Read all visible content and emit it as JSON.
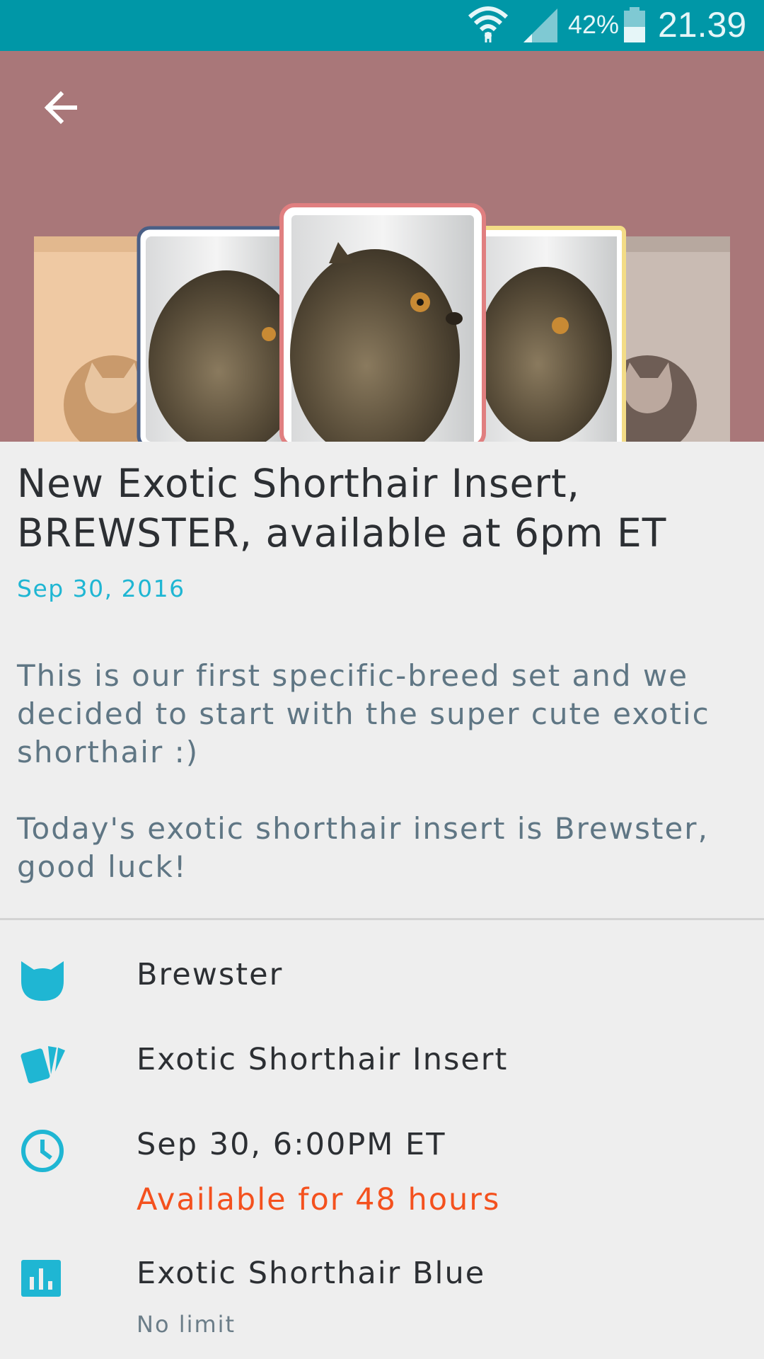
{
  "status_bar": {
    "battery_percent": "42%",
    "time": "21.39",
    "icons": [
      "wifi-icon",
      "signal-icon",
      "battery-icon"
    ]
  },
  "header": {
    "back_icon": "arrow-left-icon"
  },
  "article": {
    "title": "New Exotic Shorthair Insert, BREWSTER, available at 6pm ET",
    "date": "Sep 30, 2016",
    "paragraphs": [
      "This is our first specific-breed set and we decided to start with the super cute exotic shorthair :)",
      "Today's exotic shorthair insert is Brewster, good luck!"
    ]
  },
  "details": {
    "name": "Brewster",
    "set": "Exotic Shorthair Insert",
    "release_time": "Sep 30, 6:00PM ET",
    "availability": "Available for 48 hours",
    "variant": "Exotic Shorthair Blue",
    "limit": "No limit"
  },
  "colors": {
    "status_bar": "#0097a7",
    "hero_bg": "#a97779",
    "accent": "#1fb6d3",
    "warning": "#f4511e"
  }
}
